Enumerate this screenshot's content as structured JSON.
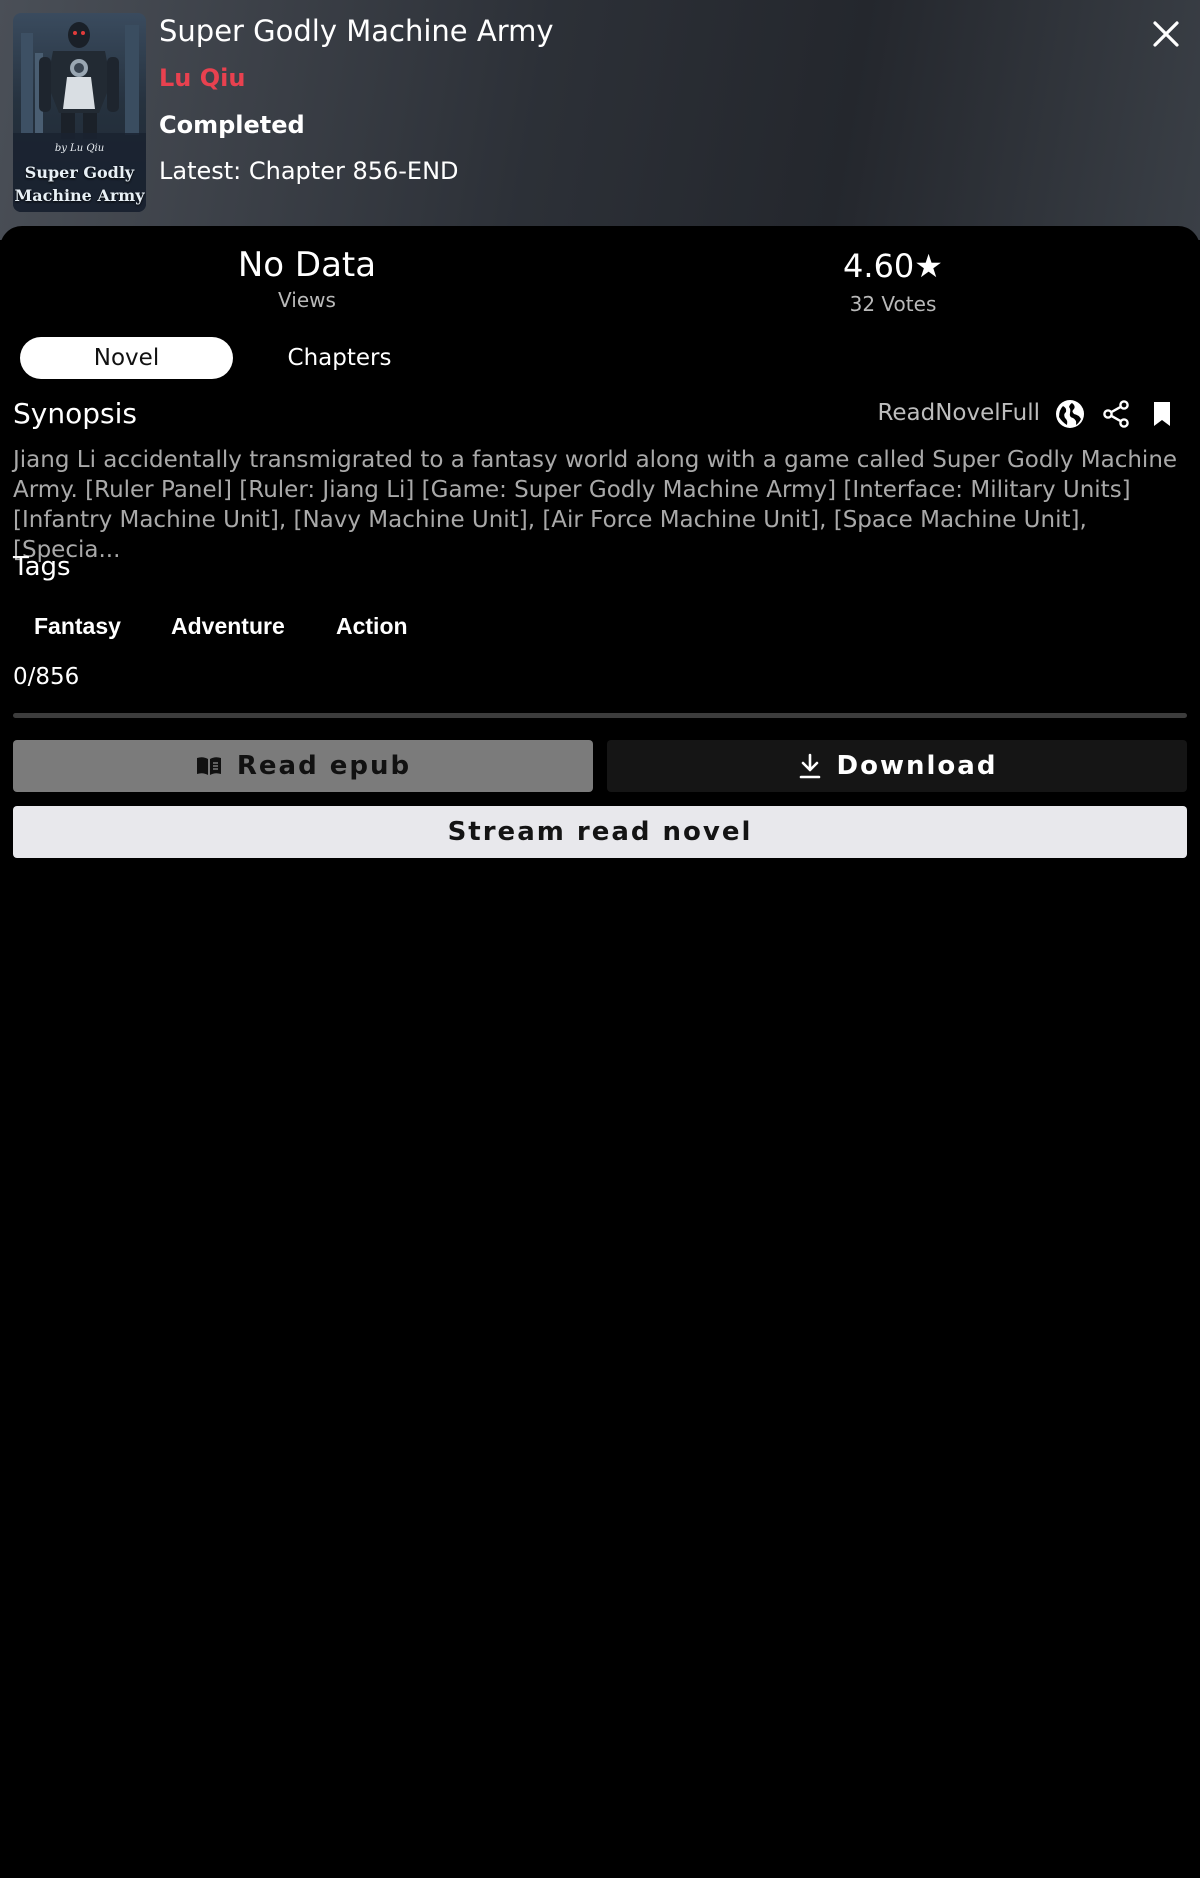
{
  "novel": {
    "title": "Super Godly Machine Army",
    "author": "Lu Qiu",
    "status": "Completed",
    "latest": "Latest: Chapter 856-END",
    "cover": {
      "by_line": "by Lu Qiu",
      "title_line1": "Super Godly",
      "title_line2": "Machine Army"
    }
  },
  "stats": {
    "views_value": "No Data",
    "views_label": "Views",
    "rating_value": "4.60",
    "rating_star": "★",
    "votes_label": "32 Votes"
  },
  "tabs": {
    "novel": "Novel",
    "chapters": "Chapters",
    "active": "Novel"
  },
  "synopsis": {
    "heading": "Synopsis",
    "source": "ReadNovelFull",
    "text": "Jiang Li accidentally transmigrated to a fantasy world along with a game called Super Godly Machine Army. [Ruler Panel] [Ruler: Jiang Li] [Game: Super Godly Machine Army] [Interface: Military Units] [Infantry Machine Unit], [Navy Machine Unit], [Air Force Machine Unit], [Space Machine Unit], [Specia..."
  },
  "tags": {
    "heading": "Tags",
    "items": [
      "Fantasy",
      "Adventure",
      "Action"
    ]
  },
  "progress": {
    "text": "0/856",
    "fraction": 0
  },
  "buttons": {
    "read_epub": "Read epub",
    "download": "Download",
    "stream": "Stream read novel"
  },
  "icons": {
    "close": "close-icon",
    "globe": "globe-icon",
    "share": "share-icon",
    "bookmark": "bookmark-icon",
    "book": "book-open-icon",
    "download": "download-icon"
  },
  "colors": {
    "author": "#e8414f",
    "active_tab_bg": "#ffffff",
    "epub_button_bg": "#7b7b7b",
    "stream_button_bg": "#e8e8ec"
  }
}
